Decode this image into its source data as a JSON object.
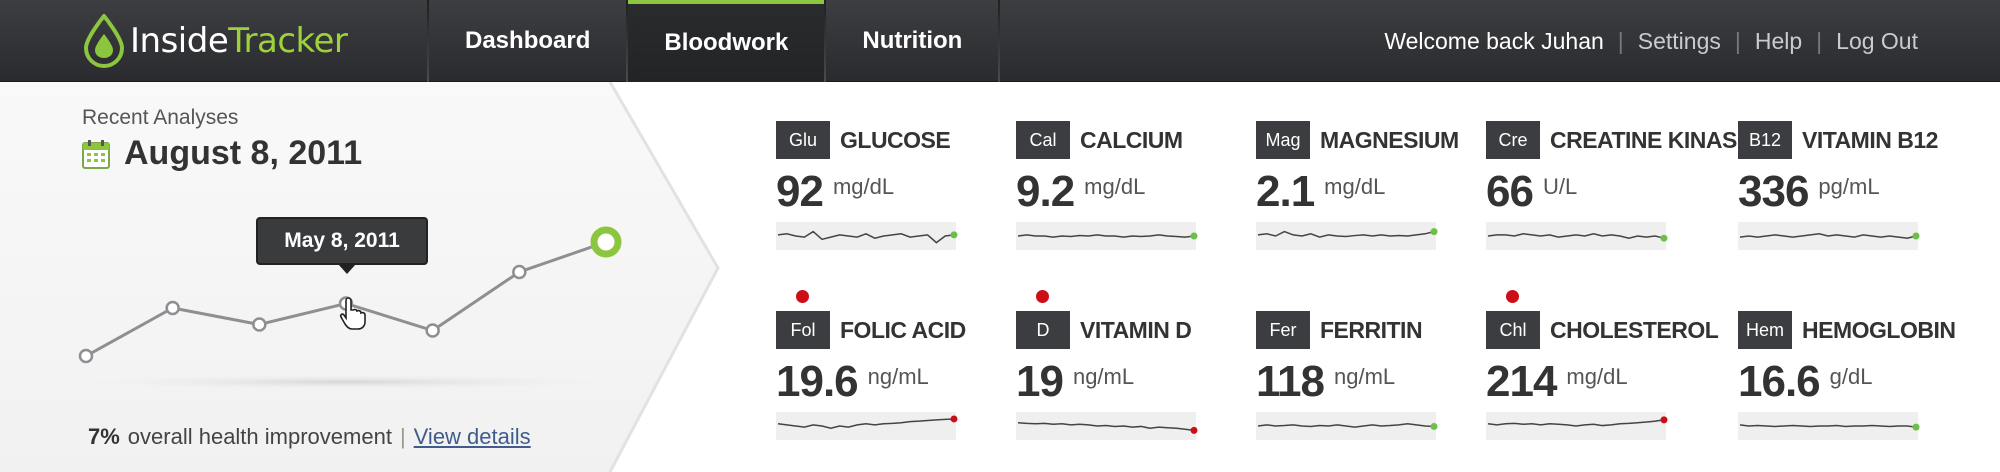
{
  "brand": {
    "name_part1": "Inside",
    "name_part2": "Tracker",
    "accent_color": "#8cc63f"
  },
  "nav": {
    "tabs": [
      {
        "label": "Dashboard",
        "active": false
      },
      {
        "label": "Bloodwork",
        "active": true
      },
      {
        "label": "Nutrition",
        "active": false
      }
    ]
  },
  "user": {
    "welcome": "Welcome back Juhan",
    "settings": "Settings",
    "help": "Help",
    "logout": "Log Out"
  },
  "analyses": {
    "label": "Recent Analyses",
    "date": "August 8, 2011",
    "tooltip": "May 8, 2011",
    "trend_values": [
      1,
      4.2,
      3.1,
      4.5,
      2.7,
      6.6,
      8.6
    ],
    "health_pct": "7%",
    "health_text": "overall health improvement",
    "health_sep": "|",
    "view_details": "View details"
  },
  "markers": [
    {
      "abbr": "Glu",
      "name": "GLUCOSE",
      "value": "92",
      "unit": "mg/dL",
      "alert": false,
      "end_color": "#6cc04a",
      "trend": [
        0.55,
        0.6,
        0.5,
        0.45,
        0.7,
        0.35,
        0.45,
        0.55,
        0.5,
        0.45,
        0.6,
        0.4,
        0.5,
        0.55,
        0.6,
        0.45,
        0.5,
        0.55,
        0.2,
        0.5,
        0.55
      ]
    },
    {
      "abbr": "Cal",
      "name": "CALCIUM",
      "value": "9.2",
      "unit": "mg/dL",
      "alert": false,
      "end_color": "#6cc04a",
      "trend": [
        0.5,
        0.55,
        0.5,
        0.5,
        0.45,
        0.5,
        0.48,
        0.52,
        0.5,
        0.55,
        0.5,
        0.5,
        0.45,
        0.5,
        0.48,
        0.5,
        0.55,
        0.5,
        0.48,
        0.45,
        0.5
      ]
    },
    {
      "abbr": "Mag",
      "name": "MAGNESIUM",
      "value": "2.1",
      "unit": "mg/dL",
      "alert": false,
      "end_color": "#6cc04a",
      "trend": [
        0.55,
        0.6,
        0.5,
        0.7,
        0.55,
        0.5,
        0.6,
        0.45,
        0.55,
        0.5,
        0.48,
        0.52,
        0.55,
        0.5,
        0.55,
        0.5,
        0.52,
        0.5,
        0.55,
        0.6,
        0.7
      ]
    },
    {
      "abbr": "Cre",
      "name": "CREATINE KINASE",
      "value": "66",
      "unit": "U/L",
      "alert": false,
      "end_color": "#6cc04a",
      "trend": [
        0.5,
        0.55,
        0.55,
        0.5,
        0.6,
        0.55,
        0.5,
        0.55,
        0.45,
        0.5,
        0.55,
        0.5,
        0.6,
        0.5,
        0.55,
        0.5,
        0.4,
        0.5,
        0.45,
        0.5,
        0.4
      ]
    },
    {
      "abbr": "B12",
      "name": "VITAMIN B12",
      "value": "336",
      "unit": "pg/mL",
      "alert": false,
      "end_color": "#6cc04a",
      "trend": [
        0.45,
        0.5,
        0.45,
        0.5,
        0.55,
        0.5,
        0.45,
        0.5,
        0.55,
        0.6,
        0.5,
        0.55,
        0.5,
        0.45,
        0.55,
        0.5,
        0.45,
        0.5,
        0.45,
        0.4,
        0.5
      ]
    },
    {
      "abbr": "Fol",
      "name": "FOLIC ACID",
      "value": "19.6",
      "unit": "ng/mL",
      "alert": true,
      "end_color": "#cc0f17",
      "trend": [
        0.6,
        0.55,
        0.5,
        0.45,
        0.55,
        0.5,
        0.4,
        0.5,
        0.45,
        0.55,
        0.6,
        0.55,
        0.6,
        0.62,
        0.65,
        0.7,
        0.72,
        0.75,
        0.78,
        0.8,
        0.82
      ]
    },
    {
      "abbr": "D",
      "name": "VITAMIN D",
      "value": "19",
      "unit": "ng/mL",
      "alert": true,
      "end_color": "#cc0f17",
      "trend": [
        0.65,
        0.62,
        0.6,
        0.62,
        0.58,
        0.6,
        0.55,
        0.58,
        0.55,
        0.5,
        0.52,
        0.48,
        0.5,
        0.45,
        0.48,
        0.4,
        0.45,
        0.42,
        0.4,
        0.35,
        0.3
      ]
    },
    {
      "abbr": "Fer",
      "name": "FERRITIN",
      "value": "118",
      "unit": "ng/mL",
      "alert": false,
      "end_color": "#6cc04a",
      "trend": [
        0.5,
        0.55,
        0.5,
        0.52,
        0.55,
        0.5,
        0.48,
        0.52,
        0.5,
        0.55,
        0.5,
        0.45,
        0.5,
        0.55,
        0.5,
        0.52,
        0.55,
        0.6,
        0.55,
        0.5,
        0.48
      ]
    },
    {
      "abbr": "Chl",
      "name": "CHOLESTEROL",
      "value": "214",
      "unit": "mg/dL",
      "alert": true,
      "end_color": "#cc0f17",
      "trend": [
        0.6,
        0.55,
        0.6,
        0.62,
        0.58,
        0.6,
        0.55,
        0.6,
        0.58,
        0.55,
        0.5,
        0.55,
        0.58,
        0.52,
        0.55,
        0.6,
        0.62,
        0.65,
        0.68,
        0.72,
        0.78
      ]
    },
    {
      "abbr": "Hem",
      "name": "HEMOGLOBIN",
      "value": "16.6",
      "unit": "g/dL",
      "alert": false,
      "end_color": "#6cc04a",
      "trend": [
        0.55,
        0.5,
        0.52,
        0.5,
        0.48,
        0.5,
        0.52,
        0.5,
        0.48,
        0.5,
        0.5,
        0.52,
        0.48,
        0.5,
        0.5,
        0.52,
        0.5,
        0.48,
        0.5,
        0.5,
        0.45
      ]
    }
  ]
}
